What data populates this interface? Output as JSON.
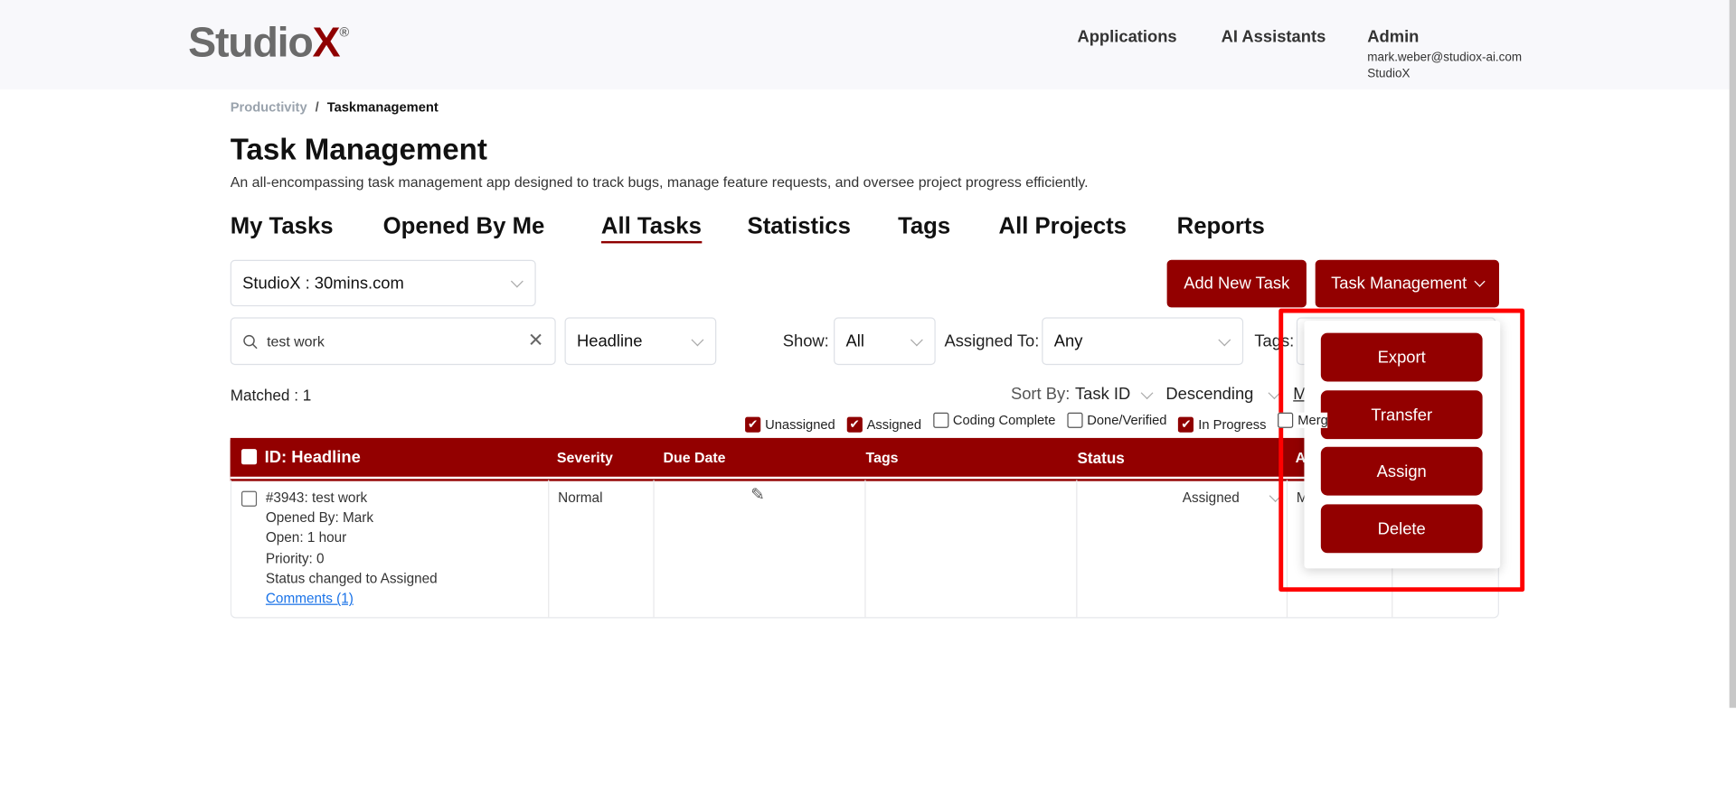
{
  "header": {
    "logo": "StudioX",
    "logo_mark": "®",
    "nav": [
      "Applications",
      "AI Assistants"
    ],
    "user": {
      "name": "Admin",
      "email": "mark.weber@studiox-ai.com",
      "org": "StudioX"
    }
  },
  "breadcrumb": {
    "parent": "Productivity",
    "separator": "/",
    "current": "Taskmanagement"
  },
  "page": {
    "title": "Task Management",
    "description": "An all-encompassing task management app designed to track bugs, manage feature requests, and oversee project progress efficiently."
  },
  "tabs": [
    {
      "label": "My Tasks"
    },
    {
      "label": "Opened By Me"
    },
    {
      "label": "All Tasks",
      "active": true
    },
    {
      "label": "Statistics"
    },
    {
      "label": "Tags"
    },
    {
      "label": "All Projects"
    },
    {
      "label": "Reports"
    }
  ],
  "project_select": "StudioX : 30mins.com",
  "buttons": {
    "add_new_task": "Add New Task",
    "task_management": "Task Management"
  },
  "filters": {
    "search_value": "test work",
    "search_field": "Headline",
    "show_label": "Show:",
    "show_value": "All",
    "assigned_label": "Assigned To:",
    "assigned_value": "Any",
    "tags_label": "Tags:"
  },
  "matched": "Matched : 1",
  "sort": {
    "label": "Sort By:",
    "field": "Task ID",
    "order": "Descending",
    "more": "M"
  },
  "status_filters": [
    {
      "label": "Unassigned",
      "checked": true
    },
    {
      "label": "Assigned",
      "checked": true
    },
    {
      "label": "Coding Complete",
      "checked": false
    },
    {
      "label": "Done/Verified",
      "checked": false
    },
    {
      "label": "In Progress",
      "checked": true
    },
    {
      "label": "Merg",
      "checked": false
    }
  ],
  "table": {
    "columns": [
      "ID: Headline",
      "Severity",
      "Due Date",
      "Tags",
      "Status",
      "A"
    ],
    "rows": [
      {
        "headline": "#3943: test work",
        "opened_by": "Opened By: Mark",
        "open": "Open: 1 hour",
        "priority": "Priority: 0",
        "status_note": "Status changed to Assigned",
        "comments": "Comments (1)",
        "severity": "Normal",
        "status": "Assigned",
        "assignee": "M"
      }
    ]
  },
  "dropdown_menu": [
    "Export",
    "Transfer",
    "Assign",
    "Delete"
  ],
  "colors": {
    "brand": "#930000",
    "highlight": "#ff0000"
  }
}
